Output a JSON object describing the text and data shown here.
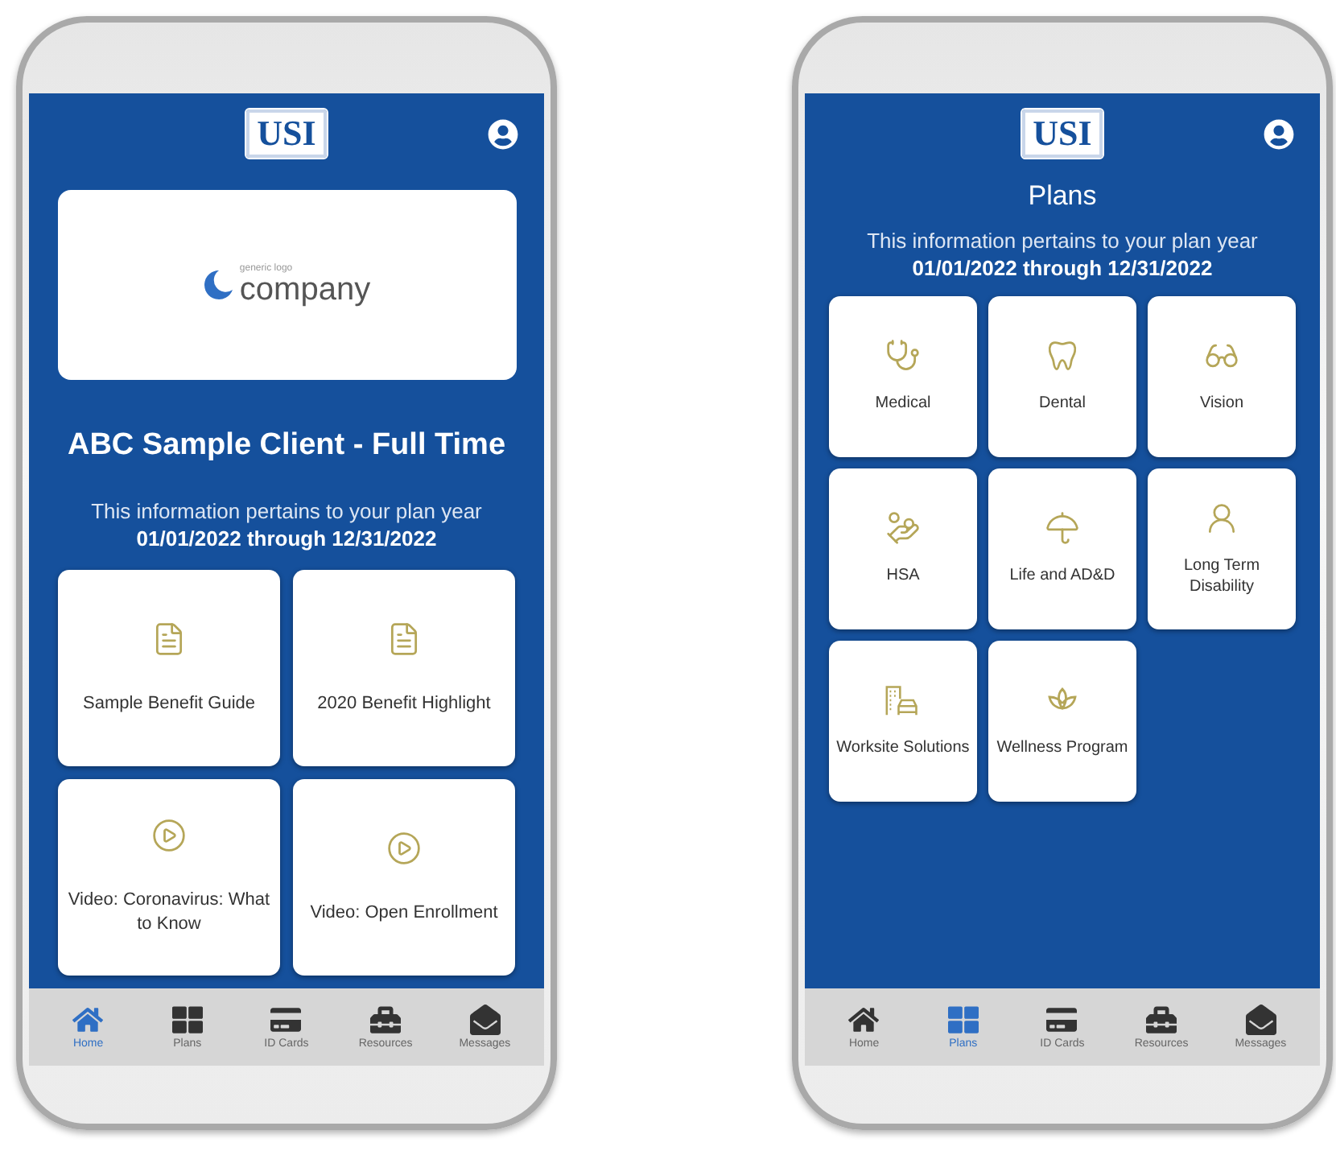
{
  "phones": [
    {
      "kind": "home",
      "logo": "USI",
      "banner": {
        "tagline": "generic logo",
        "name": "company"
      },
      "title": "ABC Sample Client - Full Time",
      "notice": "This information pertains to your plan year",
      "dates": "01/01/2022 through 12/31/2022",
      "tiles": [
        {
          "kind": "document",
          "label": "Sample Benefit Guide"
        },
        {
          "kind": "document",
          "label": "2020 Benefit Highlight"
        },
        {
          "kind": "video",
          "label": "Video: Coronavirus: What to Know"
        },
        {
          "kind": "video",
          "label": "Video: Open Enrollment"
        }
      ],
      "nav": [
        {
          "kind": "home",
          "label": "Home",
          "selected": true
        },
        {
          "kind": "plans",
          "label": "Plans",
          "selected": false
        },
        {
          "kind": "cards",
          "label": "ID Cards",
          "selected": false
        },
        {
          "kind": "resources",
          "label": "Resources",
          "selected": false
        },
        {
          "kind": "messages",
          "label": "Messages",
          "selected": false
        }
      ]
    },
    {
      "kind": "plans",
      "logo": "USI",
      "title": "Plans",
      "notice": "This information pertains to your plan year",
      "dates": "01/01/2022 through 12/31/2022",
      "tiles": [
        {
          "kind": "medical",
          "label": "Medical"
        },
        {
          "kind": "dental",
          "label": "Dental"
        },
        {
          "kind": "vision",
          "label": "Vision"
        },
        {
          "kind": "hsa",
          "label": "HSA"
        },
        {
          "kind": "life",
          "label": "Life and AD&D"
        },
        {
          "kind": "disability",
          "label": "Long Term Disability"
        },
        {
          "kind": "worksite",
          "label": "Worksite Solutions"
        },
        {
          "kind": "wellness",
          "label": "Wellness Program"
        }
      ],
      "nav": [
        {
          "kind": "home",
          "label": "Home",
          "selected": false
        },
        {
          "kind": "plans",
          "label": "Plans",
          "selected": true
        },
        {
          "kind": "cards",
          "label": "ID Cards",
          "selected": false
        },
        {
          "kind": "resources",
          "label": "Resources",
          "selected": false
        },
        {
          "kind": "messages",
          "label": "Messages",
          "selected": false
        }
      ]
    }
  ]
}
